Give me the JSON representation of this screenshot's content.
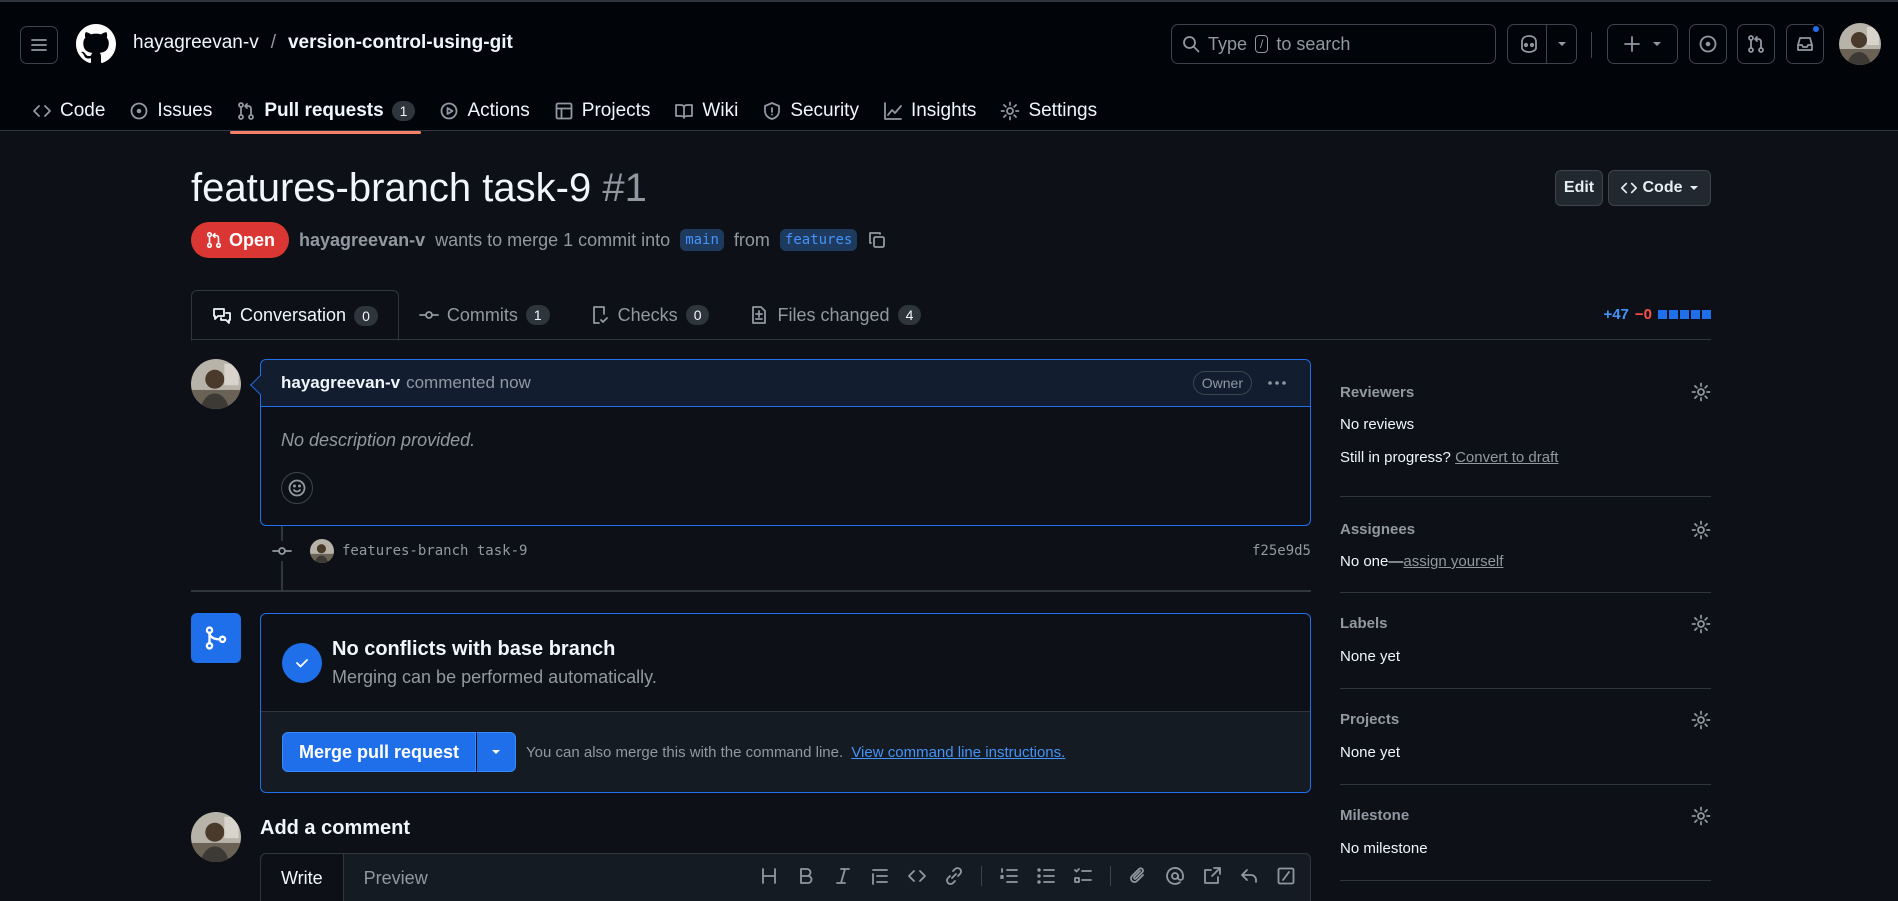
{
  "header": {
    "owner": "hayagreevan-v",
    "separator": "/",
    "repo": "version-control-using-git",
    "search_prefix": "Type",
    "search_key": "/",
    "search_suffix": "to search"
  },
  "nav": [
    {
      "label": "Code",
      "icon": "code-icon"
    },
    {
      "label": "Issues",
      "icon": "issue-icon"
    },
    {
      "label": "Pull requests",
      "icon": "pull-request-icon",
      "count": "1",
      "active": true
    },
    {
      "label": "Actions",
      "icon": "play-icon"
    },
    {
      "label": "Projects",
      "icon": "table-icon"
    },
    {
      "label": "Wiki",
      "icon": "book-icon"
    },
    {
      "label": "Security",
      "icon": "shield-icon"
    },
    {
      "label": "Insights",
      "icon": "graph-icon"
    },
    {
      "label": "Settings",
      "icon": "gear-icon"
    }
  ],
  "pr": {
    "title": "features-branch task-9",
    "number": "#1",
    "edit_label": "Edit",
    "code_label": "Code",
    "state": "Open",
    "author": "hayagreevan-v",
    "merge_text": "wants to merge 1 commit into",
    "base_branch": "main",
    "from_text": "from",
    "head_branch": "features"
  },
  "tabs": [
    {
      "label": "Conversation",
      "count": "0",
      "icon": "comment-discussion-icon",
      "active": true
    },
    {
      "label": "Commits",
      "count": "1",
      "icon": "commit-icon"
    },
    {
      "label": "Checks",
      "count": "0",
      "icon": "checklist-icon"
    },
    {
      "label": "Files changed",
      "count": "4",
      "icon": "file-diff-icon"
    }
  ],
  "diffstat": {
    "additions": "+47",
    "deletions": "−0"
  },
  "comment": {
    "author": "hayagreevan-v",
    "action": "commented now",
    "badge": "Owner",
    "body": "No description provided."
  },
  "commit": {
    "message": "features-branch task-9",
    "sha": "f25e9d5"
  },
  "merge": {
    "title": "No conflicts with base branch",
    "subtitle": "Merging can be performed automatically.",
    "button": "Merge pull request",
    "hint": "You can also merge this with the command line.",
    "link": "View command line instructions."
  },
  "add_comment": {
    "title": "Add a comment",
    "write_tab": "Write",
    "preview_tab": "Preview"
  },
  "sidebar": {
    "reviewers": {
      "title": "Reviewers",
      "value": "No reviews",
      "progress_text": "Still in progress?",
      "progress_link": "Convert to draft"
    },
    "assignees": {
      "title": "Assignees",
      "value": "No one—",
      "link": "assign yourself"
    },
    "labels": {
      "title": "Labels",
      "value": "None yet"
    },
    "projects": {
      "title": "Projects",
      "value": "None yet"
    },
    "milestone": {
      "title": "Milestone",
      "value": "No milestone"
    }
  },
  "colors": {
    "accent": "#1f6feb",
    "open_state": "#da3633",
    "background": "#0d1117",
    "header": "#010409",
    "underline": "#f78166"
  }
}
